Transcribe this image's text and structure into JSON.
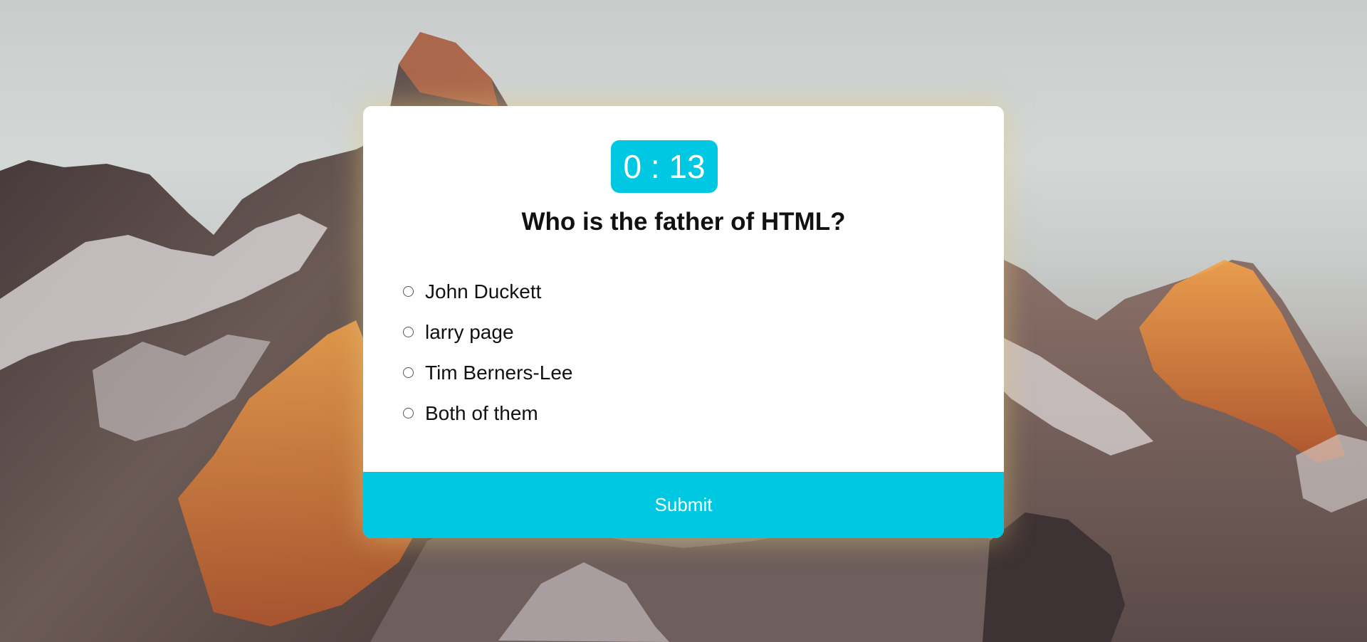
{
  "timer": {
    "text": "0 : 13"
  },
  "question": {
    "text": "Who is the father of HTML?"
  },
  "options": [
    {
      "label": "John Duckett"
    },
    {
      "label": "larry page"
    },
    {
      "label": "Tim Berners-Lee"
    },
    {
      "label": "Both of them"
    }
  ],
  "submit": {
    "label": "Submit"
  },
  "colors": {
    "accent": "#00c8e3",
    "card": "#ffffff",
    "text": "#111111"
  }
}
